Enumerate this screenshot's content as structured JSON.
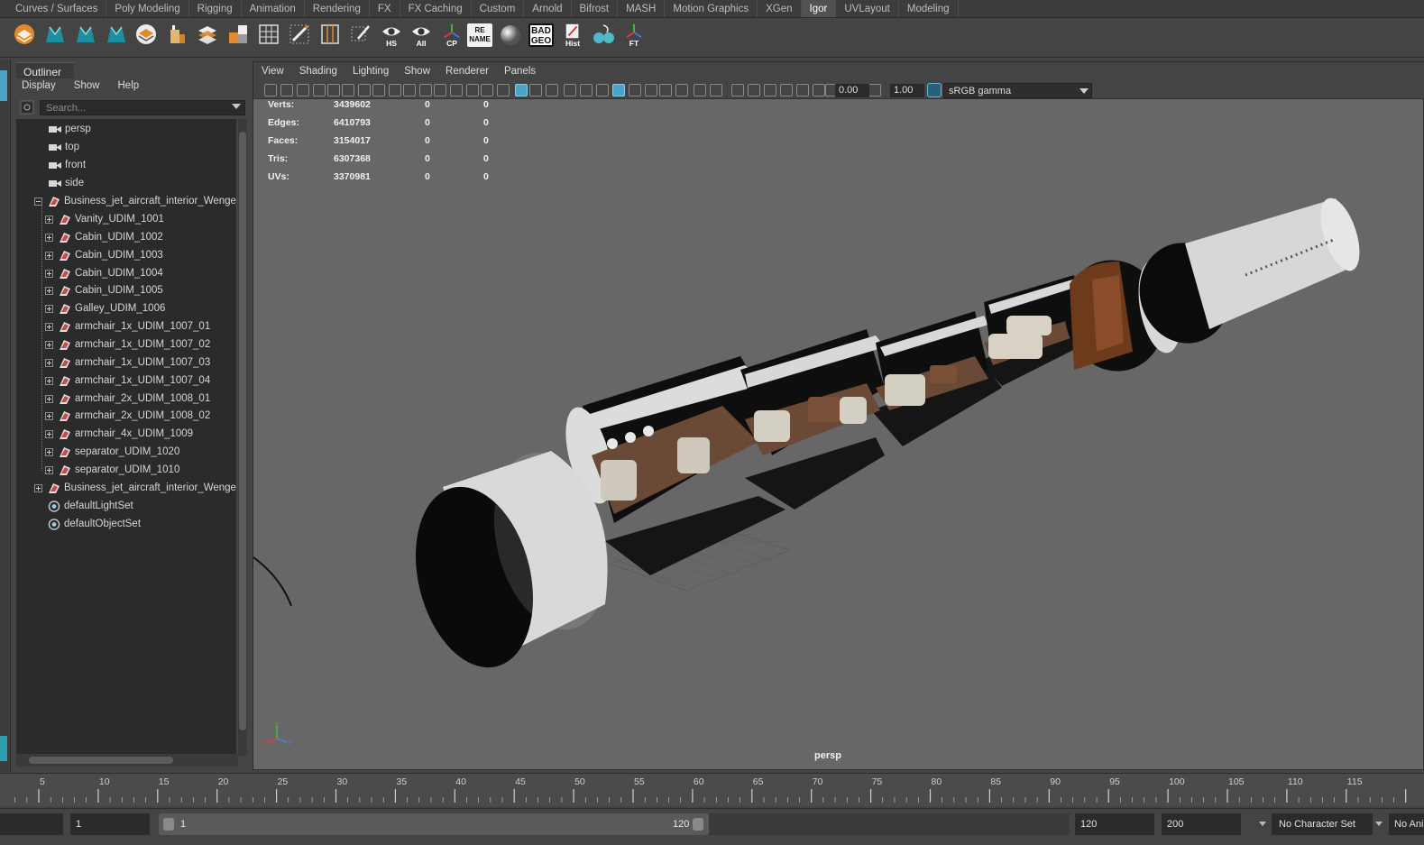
{
  "shelf_tabs": [
    "Curves / Surfaces",
    "Poly Modeling",
    "Rigging",
    "Animation",
    "Rendering",
    "FX",
    "FX Caching",
    "Custom",
    "Arnold",
    "Bifrost",
    "MASH",
    "Motion Graphics",
    "XGen",
    "Igor",
    "UVLayout",
    "Modeling"
  ],
  "active_shelf_tab": "Igor",
  "shelf_icons": {
    "hs": "HS",
    "all": "All",
    "cp": "CP",
    "rename": "RE NAME",
    "badgeo": "BAD GEO",
    "hist": "Hist",
    "ft": "FT"
  },
  "outliner": {
    "tab": "Outliner",
    "menu": [
      "Display",
      "Show",
      "Help"
    ],
    "search_placeholder": "Search...",
    "cameras": [
      "persp",
      "top",
      "front",
      "side"
    ],
    "group1": "Business_jet_aircraft_interior_Wenge_",
    "children": [
      "Vanity_UDIM_1001",
      "Cabin_UDIM_1002",
      "Cabin_UDIM_1003",
      "Cabin_UDIM_1004",
      "Cabin_UDIM_1005",
      "Galley_UDIM_1006",
      "armchair_1x_UDIM_1007_01",
      "armchair_1x_UDIM_1007_02",
      "armchair_1x_UDIM_1007_03",
      "armchair_1x_UDIM_1007_04",
      "armchair_2x_UDIM_1008_01",
      "armchair_2x_UDIM_1008_02",
      "armchair_4x_UDIM_1009",
      "separator_UDIM_1020",
      "separator_UDIM_1010"
    ],
    "group2": "Business_jet_aircraft_interior_Wenge_",
    "sets": [
      "defaultLightSet",
      "defaultObjectSet"
    ]
  },
  "viewport": {
    "menu": [
      "View",
      "Shading",
      "Lighting",
      "Show",
      "Renderer",
      "Panels"
    ],
    "exposure": "0.00",
    "gamma": "1.00",
    "color_space": "sRGB gamma",
    "camera_label": "persp",
    "hud": [
      {
        "label": "Verts:",
        "v1": "3439602",
        "v2": "0",
        "v3": "0"
      },
      {
        "label": "Edges:",
        "v1": "6410793",
        "v2": "0",
        "v3": "0"
      },
      {
        "label": "Faces:",
        "v1": "3154017",
        "v2": "0",
        "v3": "0"
      },
      {
        "label": "Tris:",
        "v1": "6307368",
        "v2": "0",
        "v3": "0"
      },
      {
        "label": "UVs:",
        "v1": "3370981",
        "v2": "0",
        "v3": "0"
      }
    ]
  },
  "timeline": {
    "ticks": [
      "5",
      "10",
      "15",
      "20",
      "25",
      "30",
      "35",
      "40",
      "45",
      "50",
      "55",
      "60",
      "65",
      "70",
      "75",
      "80",
      "85",
      "90",
      "95",
      "100",
      "105",
      "110",
      "115"
    ]
  },
  "range": {
    "current_frame": "1",
    "slider_start": "1",
    "slider_end": "120",
    "end_frame": "120",
    "max_frame": "200",
    "character_set": "No Character Set",
    "anim_layer": "No Anim Layer"
  },
  "colors": {
    "accent": "#4ba3c7",
    "viewport_bg": "#676767",
    "panel_bg": "#444444"
  }
}
